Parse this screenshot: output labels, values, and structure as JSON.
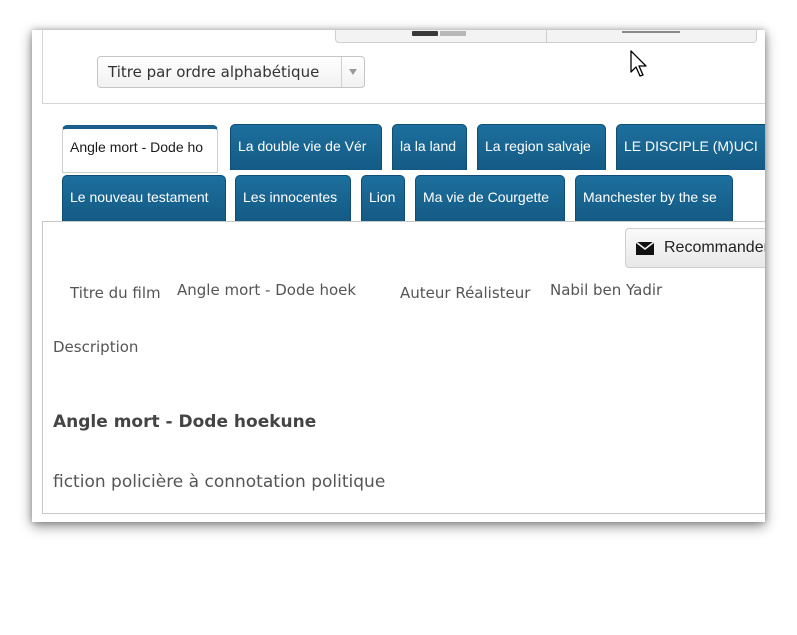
{
  "sort": {
    "label": "Titre par ordre alphabétique"
  },
  "tabs": [
    {
      "label": "Angle mort - Dode ho",
      "active": true
    },
    {
      "label": "La double vie de Vér"
    },
    {
      "label": "la la land"
    },
    {
      "label": "La region salvaje"
    },
    {
      "label": "LE DISCIPLE (M)UCI"
    },
    {
      "label": "Le nouveau testament"
    },
    {
      "label": "Les innocentes"
    },
    {
      "label": "Lion"
    },
    {
      "label": "Ma vie de Courgette"
    },
    {
      "label": "Manchester by the se"
    }
  ],
  "detail": {
    "recommend_label": "Recommander",
    "title_field_label": "Titre du film",
    "title_value": "Angle mort - Dode hoek",
    "author_field_label": "Auteur Réalisteur",
    "author_value": "Nabil ben Yadir",
    "description_label": "Description",
    "movie_heading": "Angle mort - Dode hoekune",
    "movie_description": "fiction policière à connotation politique"
  },
  "colors": {
    "tab": "#1b6a97",
    "tab_border": "#0f4d74",
    "active_tab_top": "#1b5e8c"
  }
}
